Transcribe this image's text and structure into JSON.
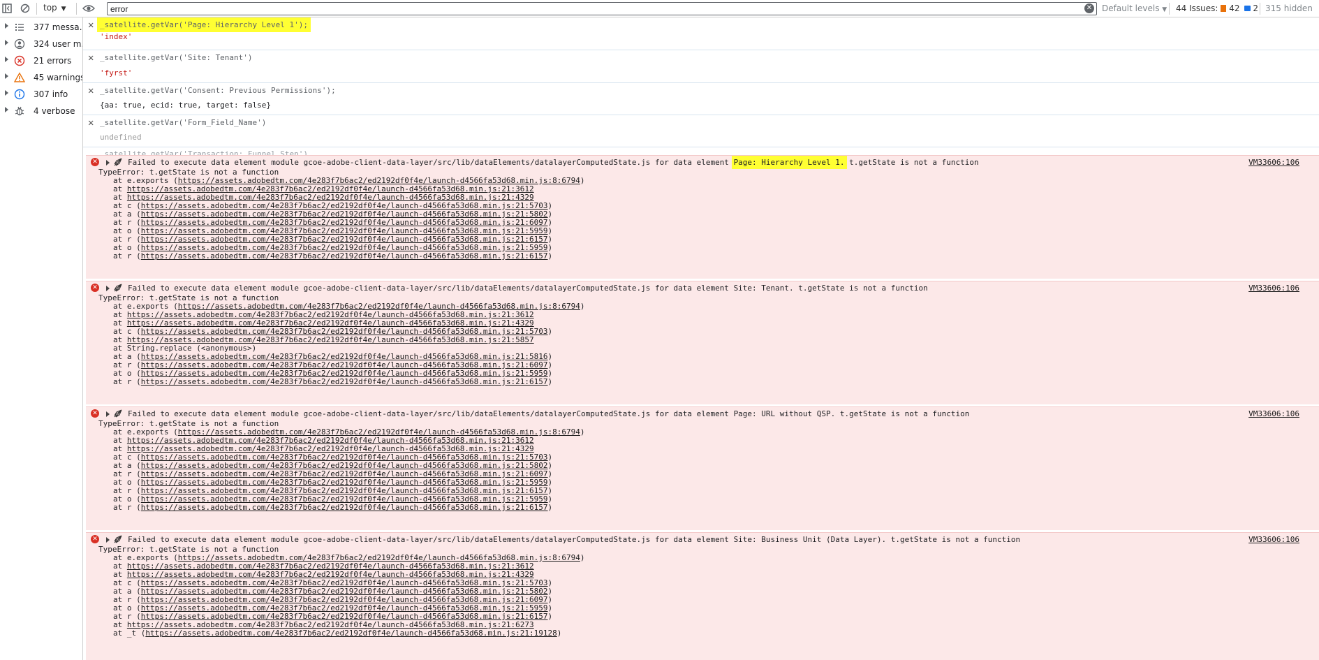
{
  "toolbar": {
    "context": "top",
    "filter_value": "error",
    "levels": "Default levels",
    "issues_label": "44 Issues:",
    "issues_warn": "42",
    "issues_info": "2",
    "hidden": "315 hidden"
  },
  "sidebar": {
    "items": [
      {
        "label": "377 messa…",
        "icon": "list-icon"
      },
      {
        "label": "324 user m…",
        "icon": "user-icon"
      },
      {
        "label": "21 errors",
        "icon": "error-icon"
      },
      {
        "label": "45 warnings",
        "icon": "warning-icon"
      },
      {
        "label": "307 info",
        "icon": "info-icon"
      },
      {
        "label": "4 verbose",
        "icon": "bug-icon"
      }
    ]
  },
  "entries": [
    {
      "cmd": "_satellite.getVar('Page: Hierarchy Level 1');",
      "result": "'index'"
    },
    {
      "cmd": "_satellite.getVar('Site: Tenant')",
      "result": "'fyrst'"
    },
    {
      "cmd": "_satellite.getVar('Consent: Previous Permissions');",
      "result": "{aa: true, ecid: true, target: false}"
    },
    {
      "cmd": "_satellite.getVar('Form_Field_Name')",
      "result": "undefined"
    },
    {
      "cmd": "_satellite.getVar('Transaction: Funnel Step')"
    }
  ],
  "errors": [
    {
      "pre": "Failed to execute data element module gcoe-adobe-client-data-layer/src/lib/dataElements/datalayerComputedState.js for data element ",
      "element": "Page: Hierarchy Level 1.",
      "post": " t.getState is not a function",
      "source": "VM33606:106",
      "type": "TypeError: t.getState is not a function",
      "frames": [
        {
          "fn": "at e.exports (",
          "url": "https://assets.adobedtm.com/4e283f7b6ac2/ed2192df0f4e/launch-d4566fa53d68.min.js:8:6794",
          "close": ")"
        },
        {
          "fn": "at ",
          "url": "https://assets.adobedtm.com/4e283f7b6ac2/ed2192df0f4e/launch-d4566fa53d68.min.js:21:3612",
          "close": ""
        },
        {
          "fn": "at ",
          "url": "https://assets.adobedtm.com/4e283f7b6ac2/ed2192df0f4e/launch-d4566fa53d68.min.js:21:4329",
          "close": ""
        },
        {
          "fn": "at c (",
          "url": "https://assets.adobedtm.com/4e283f7b6ac2/ed2192df0f4e/launch-d4566fa53d68.min.js:21:5703",
          "close": ")"
        },
        {
          "fn": "at a (",
          "url": "https://assets.adobedtm.com/4e283f7b6ac2/ed2192df0f4e/launch-d4566fa53d68.min.js:21:5802",
          "close": ")"
        },
        {
          "fn": "at r (",
          "url": "https://assets.adobedtm.com/4e283f7b6ac2/ed2192df0f4e/launch-d4566fa53d68.min.js:21:6097",
          "close": ")"
        },
        {
          "fn": "at o (",
          "url": "https://assets.adobedtm.com/4e283f7b6ac2/ed2192df0f4e/launch-d4566fa53d68.min.js:21:5959",
          "close": ")"
        },
        {
          "fn": "at r (",
          "url": "https://assets.adobedtm.com/4e283f7b6ac2/ed2192df0f4e/launch-d4566fa53d68.min.js:21:6157",
          "close": ")"
        },
        {
          "fn": "at o (",
          "url": "https://assets.adobedtm.com/4e283f7b6ac2/ed2192df0f4e/launch-d4566fa53d68.min.js:21:5959",
          "close": ")"
        },
        {
          "fn": "at r (",
          "url": "https://assets.adobedtm.com/4e283f7b6ac2/ed2192df0f4e/launch-d4566fa53d68.min.js:21:6157",
          "close": ")"
        }
      ]
    },
    {
      "pre": "Failed to execute data element module gcoe-adobe-client-data-layer/src/lib/dataElements/datalayerComputedState.js for data element ",
      "element": "Site: Tenant.",
      "post": " t.getState is not a function",
      "source": "VM33606:106",
      "type": "TypeError: t.getState is not a function",
      "frames": [
        {
          "fn": "at e.exports (",
          "url": "https://assets.adobedtm.com/4e283f7b6ac2/ed2192df0f4e/launch-d4566fa53d68.min.js:8:6794",
          "close": ")"
        },
        {
          "fn": "at ",
          "url": "https://assets.adobedtm.com/4e283f7b6ac2/ed2192df0f4e/launch-d4566fa53d68.min.js:21:3612",
          "close": ""
        },
        {
          "fn": "at ",
          "url": "https://assets.adobedtm.com/4e283f7b6ac2/ed2192df0f4e/launch-d4566fa53d68.min.js:21:4329",
          "close": ""
        },
        {
          "fn": "at c (",
          "url": "https://assets.adobedtm.com/4e283f7b6ac2/ed2192df0f4e/launch-d4566fa53d68.min.js:21:5703",
          "close": ")"
        },
        {
          "fn": "at ",
          "url": "https://assets.adobedtm.com/4e283f7b6ac2/ed2192df0f4e/launch-d4566fa53d68.min.js:21:5857",
          "close": ""
        },
        {
          "fn": "at String.replace (<anonymous>)",
          "url": "",
          "close": ""
        },
        {
          "fn": "at a (",
          "url": "https://assets.adobedtm.com/4e283f7b6ac2/ed2192df0f4e/launch-d4566fa53d68.min.js:21:5816",
          "close": ")"
        },
        {
          "fn": "at r (",
          "url": "https://assets.adobedtm.com/4e283f7b6ac2/ed2192df0f4e/launch-d4566fa53d68.min.js:21:6097",
          "close": ")"
        },
        {
          "fn": "at o (",
          "url": "https://assets.adobedtm.com/4e283f7b6ac2/ed2192df0f4e/launch-d4566fa53d68.min.js:21:5959",
          "close": ")"
        },
        {
          "fn": "at r (",
          "url": "https://assets.adobedtm.com/4e283f7b6ac2/ed2192df0f4e/launch-d4566fa53d68.min.js:21:6157",
          "close": ")"
        }
      ]
    },
    {
      "pre": "Failed to execute data element module gcoe-adobe-client-data-layer/src/lib/dataElements/datalayerComputedState.js for data element ",
      "element": "Page: URL without QSP.",
      "post": " t.getState is not a function",
      "source": "VM33606:106",
      "type": "TypeError: t.getState is not a function",
      "frames": [
        {
          "fn": "at e.exports (",
          "url": "https://assets.adobedtm.com/4e283f7b6ac2/ed2192df0f4e/launch-d4566fa53d68.min.js:8:6794",
          "close": ")"
        },
        {
          "fn": "at ",
          "url": "https://assets.adobedtm.com/4e283f7b6ac2/ed2192df0f4e/launch-d4566fa53d68.min.js:21:3612",
          "close": ""
        },
        {
          "fn": "at ",
          "url": "https://assets.adobedtm.com/4e283f7b6ac2/ed2192df0f4e/launch-d4566fa53d68.min.js:21:4329",
          "close": ""
        },
        {
          "fn": "at c (",
          "url": "https://assets.adobedtm.com/4e283f7b6ac2/ed2192df0f4e/launch-d4566fa53d68.min.js:21:5703",
          "close": ")"
        },
        {
          "fn": "at a (",
          "url": "https://assets.adobedtm.com/4e283f7b6ac2/ed2192df0f4e/launch-d4566fa53d68.min.js:21:5802",
          "close": ")"
        },
        {
          "fn": "at r (",
          "url": "https://assets.adobedtm.com/4e283f7b6ac2/ed2192df0f4e/launch-d4566fa53d68.min.js:21:6097",
          "close": ")"
        },
        {
          "fn": "at o (",
          "url": "https://assets.adobedtm.com/4e283f7b6ac2/ed2192df0f4e/launch-d4566fa53d68.min.js:21:5959",
          "close": ")"
        },
        {
          "fn": "at r (",
          "url": "https://assets.adobedtm.com/4e283f7b6ac2/ed2192df0f4e/launch-d4566fa53d68.min.js:21:6157",
          "close": ")"
        },
        {
          "fn": "at o (",
          "url": "https://assets.adobedtm.com/4e283f7b6ac2/ed2192df0f4e/launch-d4566fa53d68.min.js:21:5959",
          "close": ")"
        },
        {
          "fn": "at r (",
          "url": "https://assets.adobedtm.com/4e283f7b6ac2/ed2192df0f4e/launch-d4566fa53d68.min.js:21:6157",
          "close": ")"
        }
      ]
    },
    {
      "pre": "Failed to execute data element module gcoe-adobe-client-data-layer/src/lib/dataElements/datalayerComputedState.js for data element ",
      "element": "Site: Business Unit (Data Layer).",
      "post": " t.getState is not a function",
      "source": "VM33606:106",
      "type": "TypeError: t.getState is not a function",
      "frames": [
        {
          "fn": "at e.exports (",
          "url": "https://assets.adobedtm.com/4e283f7b6ac2/ed2192df0f4e/launch-d4566fa53d68.min.js:8:6794",
          "close": ")"
        },
        {
          "fn": "at ",
          "url": "https://assets.adobedtm.com/4e283f7b6ac2/ed2192df0f4e/launch-d4566fa53d68.min.js:21:3612",
          "close": ""
        },
        {
          "fn": "at ",
          "url": "https://assets.adobedtm.com/4e283f7b6ac2/ed2192df0f4e/launch-d4566fa53d68.min.js:21:4329",
          "close": ""
        },
        {
          "fn": "at c (",
          "url": "https://assets.adobedtm.com/4e283f7b6ac2/ed2192df0f4e/launch-d4566fa53d68.min.js:21:5703",
          "close": ")"
        },
        {
          "fn": "at a (",
          "url": "https://assets.adobedtm.com/4e283f7b6ac2/ed2192df0f4e/launch-d4566fa53d68.min.js:21:5802",
          "close": ")"
        },
        {
          "fn": "at r (",
          "url": "https://assets.adobedtm.com/4e283f7b6ac2/ed2192df0f4e/launch-d4566fa53d68.min.js:21:6097",
          "close": ")"
        },
        {
          "fn": "at o (",
          "url": "https://assets.adobedtm.com/4e283f7b6ac2/ed2192df0f4e/launch-d4566fa53d68.min.js:21:5959",
          "close": ")"
        },
        {
          "fn": "at r (",
          "url": "https://assets.adobedtm.com/4e283f7b6ac2/ed2192df0f4e/launch-d4566fa53d68.min.js:21:6157",
          "close": ")"
        },
        {
          "fn": "at ",
          "url": "https://assets.adobedtm.com/4e283f7b6ac2/ed2192df0f4e/launch-d4566fa53d68.min.js:21:6273",
          "close": ""
        },
        {
          "fn": "at _t (",
          "url": "https://assets.adobedtm.com/4e283f7b6ac2/ed2192df0f4e/launch-d4566fa53d68.min.js:21:19128",
          "close": ")"
        }
      ]
    }
  ]
}
